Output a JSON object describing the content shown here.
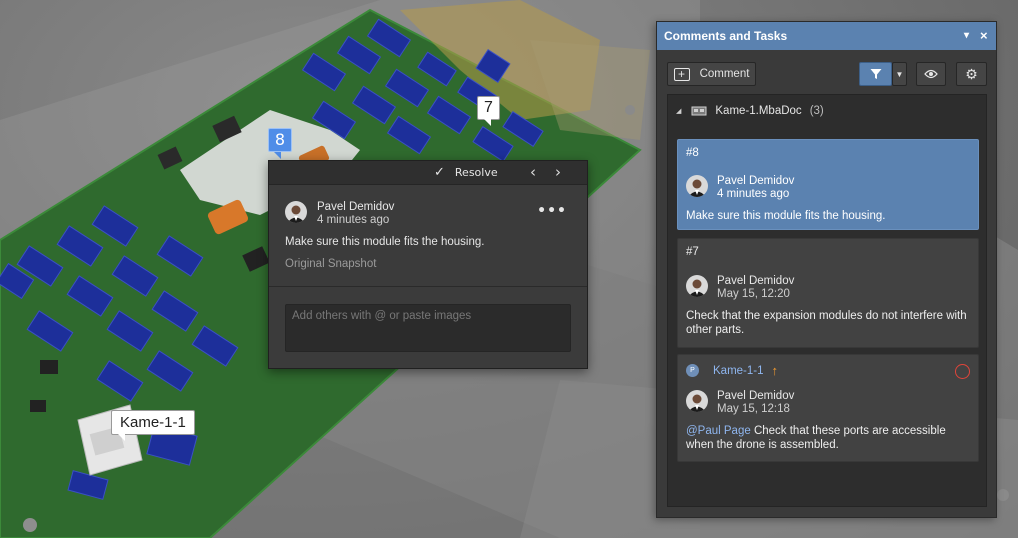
{
  "viewport": {
    "pins": {
      "pin7": "7",
      "pin8": "8",
      "kame": "Kame-1-1"
    }
  },
  "popup": {
    "resolve_label": "Resolve",
    "prev_icon": "chevron-left-icon",
    "next_icon": "chevron-right-icon",
    "author": "Pavel Demidov",
    "time": "4 minutes ago",
    "message": "Make sure this module fits the housing.",
    "snapshot_link": "Original Snapshot",
    "more_icon": "ellipsis-icon",
    "reply_placeholder": "Add others with @ or paste images"
  },
  "panel": {
    "title": "Comments and Tasks",
    "dropdown_glyph": "▾",
    "close_glyph": "×",
    "comment_button": "Comment",
    "doc": {
      "name": "Kame-1.MbaDoc",
      "count": "(3)"
    },
    "comments": [
      {
        "num": "#8",
        "author": "Pavel Demidov",
        "time": "4 minutes ago",
        "text": "Make sure this module fits the housing.",
        "selected": true
      },
      {
        "num": "#7",
        "author": "Pavel Demidov",
        "time": "May 15, 12:20",
        "text": "Check that the expansion modules do not interfere with other parts."
      },
      {
        "ref_badge": "P",
        "ref": "Kame-1-1",
        "author": "Pavel Demidov",
        "time": "May 15, 12:18",
        "mention": "@Paul Page",
        "text": " Check that these ports are accessible when the drone is assembled."
      }
    ]
  },
  "colors": {
    "accent": "#5b82b0",
    "pin_blue": "#4f8de8",
    "link": "#8fb6ef",
    "resolve_ring": "#e0453a",
    "arrow": "#f09a2f"
  }
}
